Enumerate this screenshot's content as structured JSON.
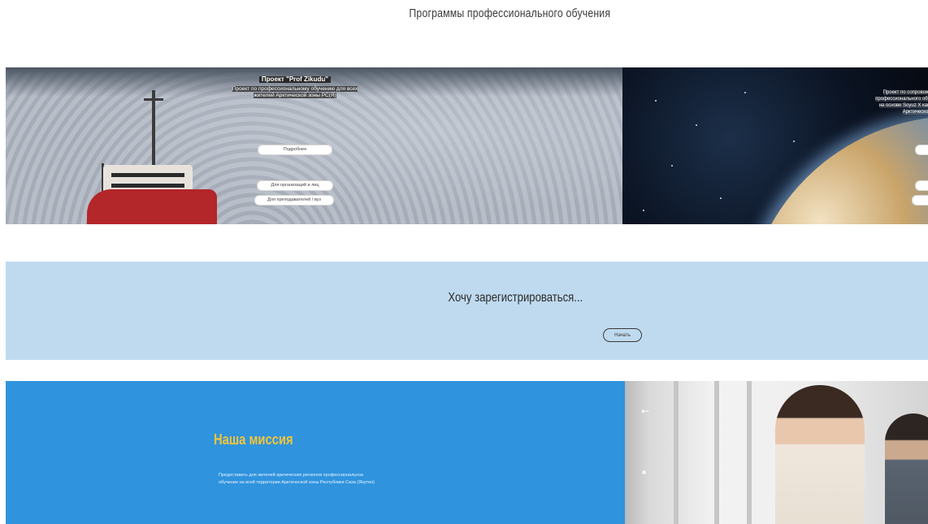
{
  "header": {
    "title": "Программы профессионального обучения"
  },
  "slider": {
    "slides": [
      {
        "title": "Проект \"Prof Zikudu\"",
        "description": "Проект по профессиональному обучению для всех жителей Арктической зоны РС(Я)",
        "buttons": [
          {
            "label": "Подробнее"
          },
          {
            "label": "Для организаций и лиц"
          },
          {
            "label": "Для преподавателей / вуз"
          }
        ]
      },
      {
        "title": "Проект по сопровождению профессионального обучения на основе Soyuz X как части Арктической зоны",
        "buttons": [
          {
            "label": ""
          },
          {
            "label": ""
          },
          {
            "label": ""
          }
        ]
      }
    ]
  },
  "register": {
    "title": "Хочу зарегистрироваться...",
    "button_label": "Начать"
  },
  "mission": {
    "title": "Наша миссия",
    "text": "Предоставить для жителей арктических регионов профессиональное обучение на всей территории Арктической зоны Республики Саха (Якутия)"
  },
  "icons": {
    "arrow": "arrow-left-icon",
    "dot": "slider-dot-icon"
  },
  "colors": {
    "register_bg": "#bfdaef",
    "mission_bg": "#2f93dd",
    "mission_title": "#f2c63a"
  }
}
